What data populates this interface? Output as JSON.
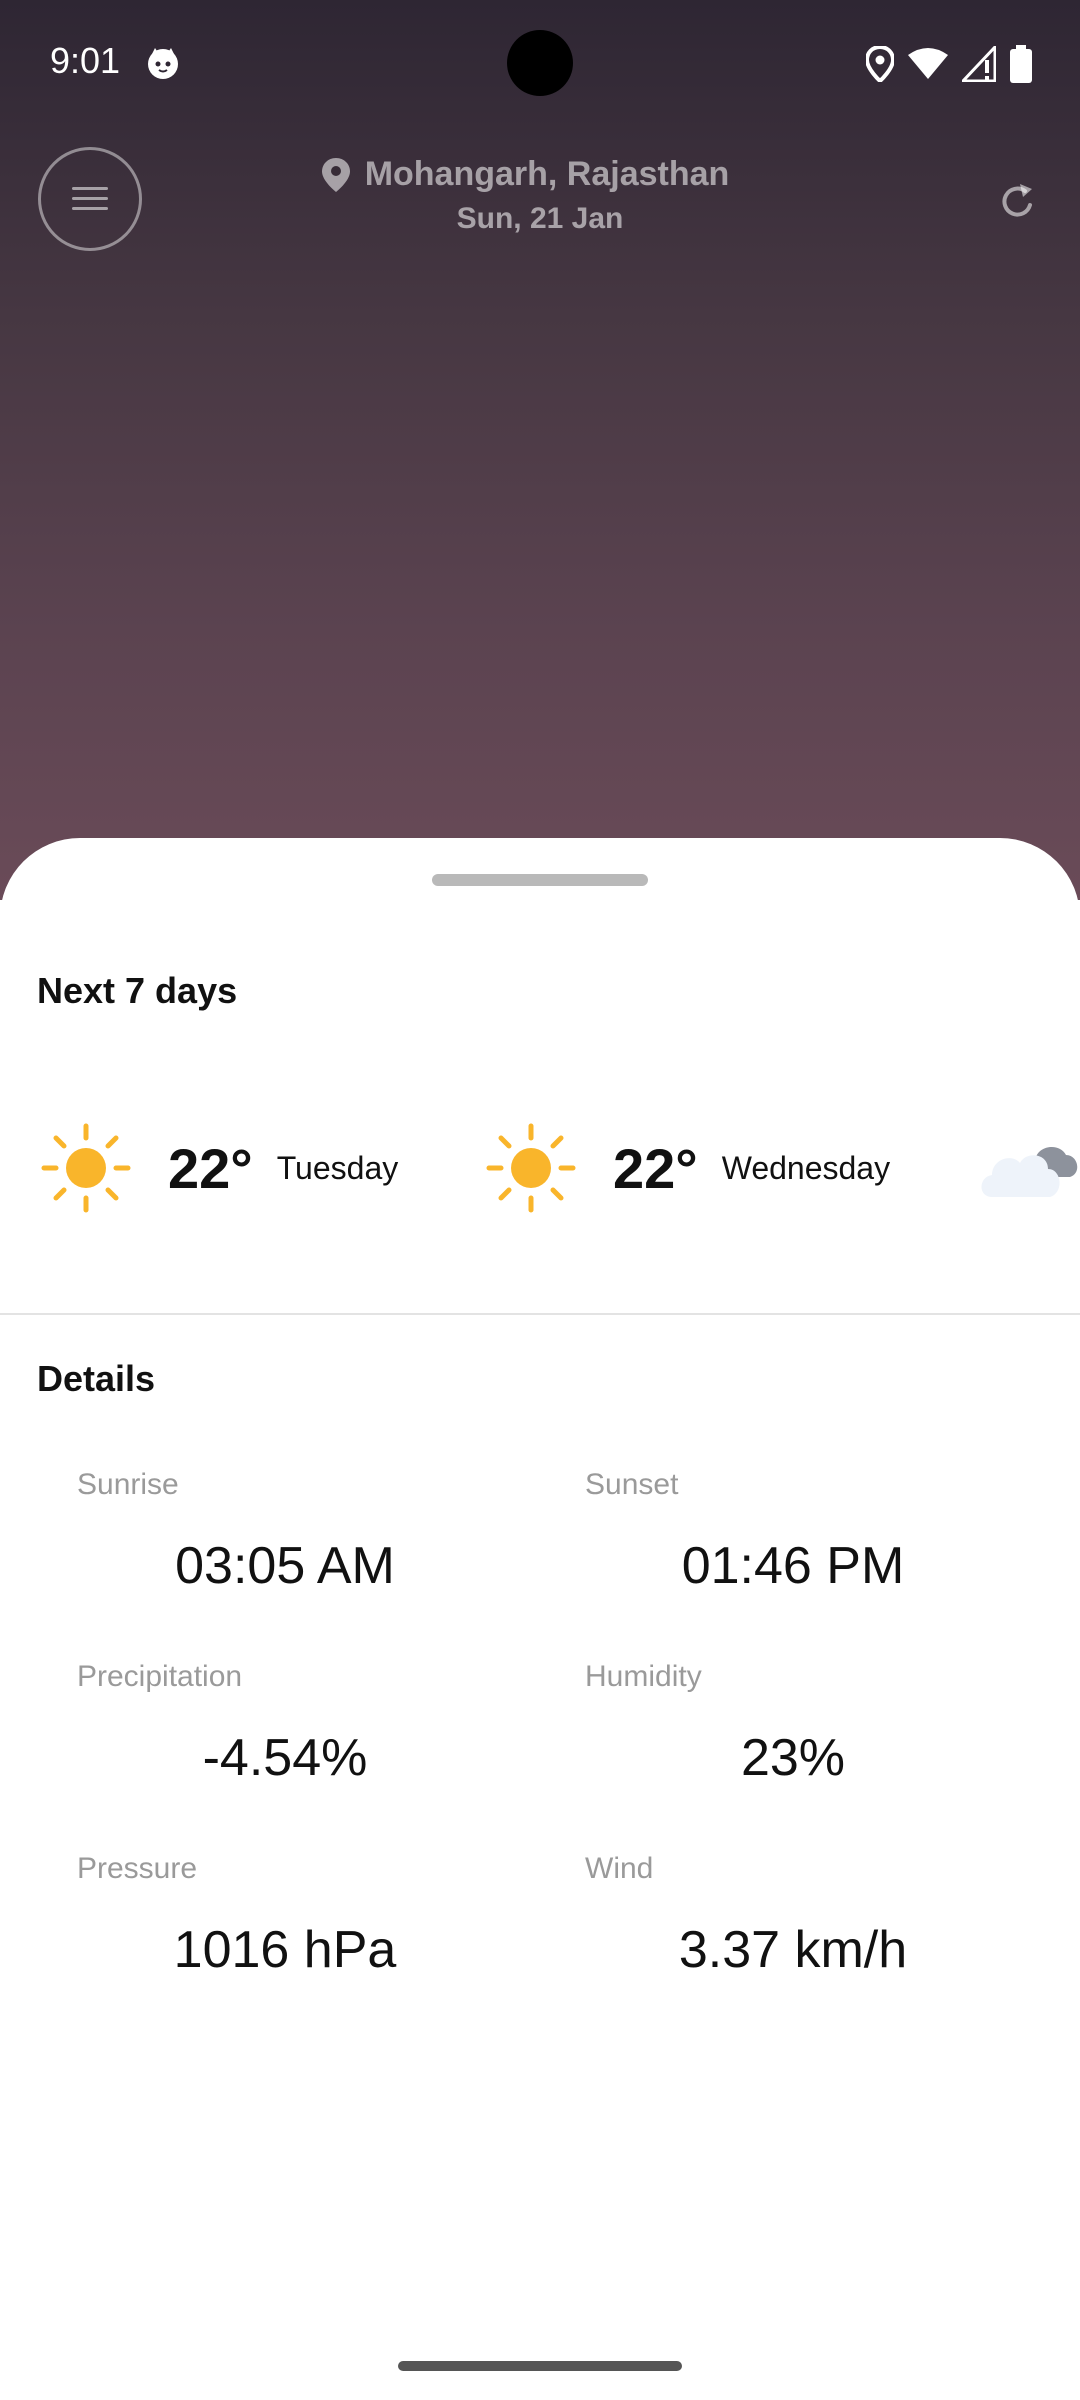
{
  "status_bar": {
    "time": "9:01",
    "icons": [
      "cat-face-icon",
      "location-icon",
      "wifi-icon",
      "signal-icon",
      "battery-icon"
    ]
  },
  "header": {
    "location": "Mohangarh, Rajasthan",
    "date": "Sun, 21 Jan",
    "icons": [
      "menu-icon",
      "location-pin-icon",
      "refresh-icon"
    ]
  },
  "forecast": {
    "title": "Next 7 days",
    "days": [
      {
        "day": "Tuesday",
        "temp": "22°",
        "icon": "sun-icon"
      },
      {
        "day": "Wednesday",
        "temp": "22°",
        "icon": "sun-icon"
      },
      {
        "day": "",
        "temp": "",
        "icon": "cloud-icon"
      }
    ]
  },
  "details": {
    "title": "Details",
    "items": [
      {
        "label": "Sunrise",
        "value": "03:05 AM"
      },
      {
        "label": "Sunset",
        "value": "01:46 PM"
      },
      {
        "label": "Precipitation",
        "value": "-4.54%"
      },
      {
        "label": "Humidity",
        "value": "23%"
      },
      {
        "label": "Pressure",
        "value": "1016 hPa"
      },
      {
        "label": "Wind",
        "value": "3.37 km/h"
      }
    ]
  },
  "colors": {
    "hero_top": "#2e2633",
    "hero_bottom": "#6a4b58",
    "sun": "#f9b52b",
    "sheet": "#ffffff"
  }
}
